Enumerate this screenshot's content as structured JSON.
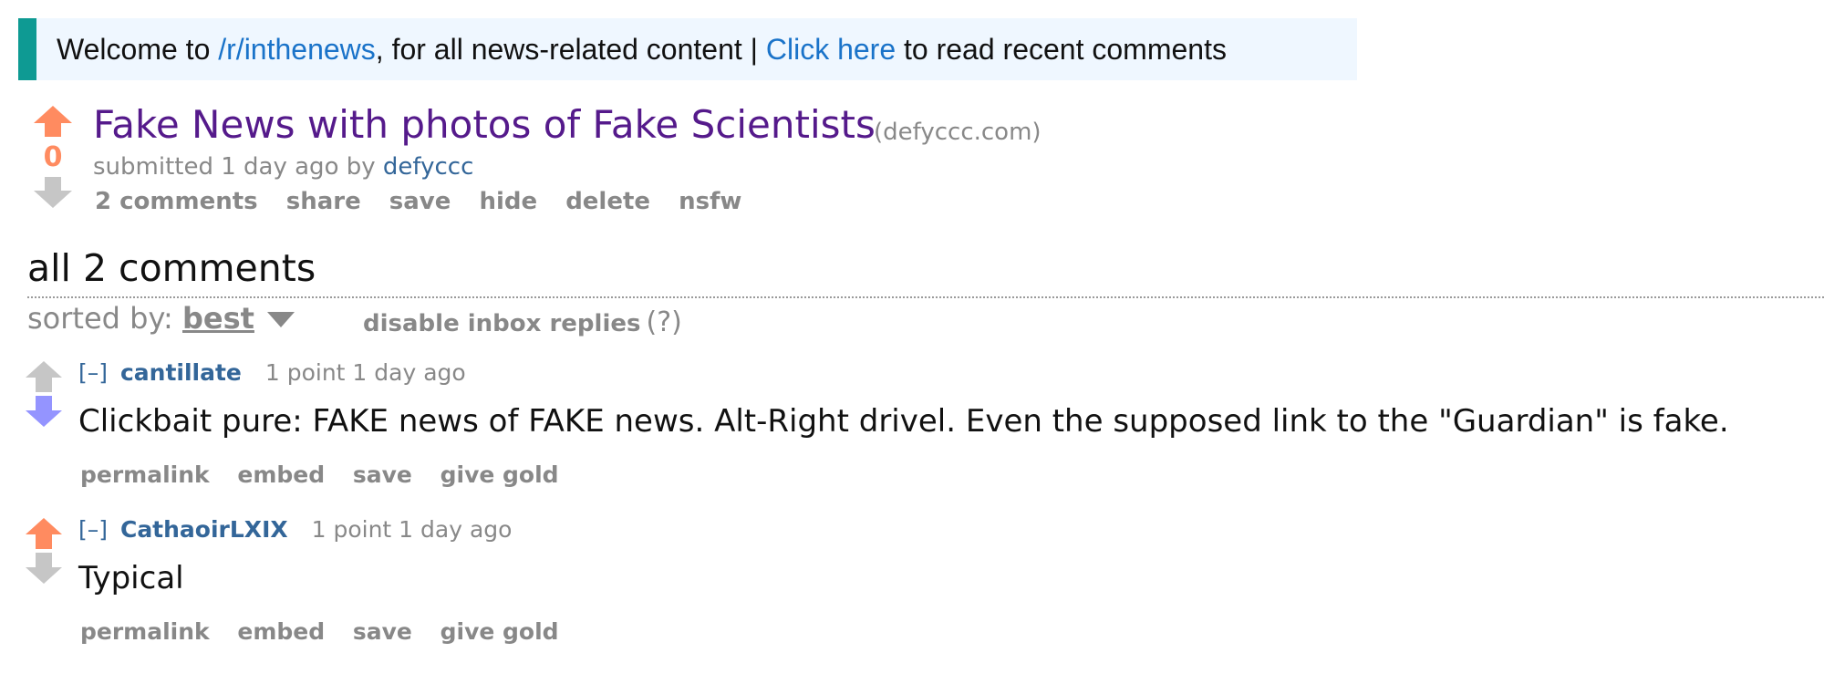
{
  "banner": {
    "prefix": "Welcome to ",
    "subreddit_link": "/r/inthenews",
    "middle": ", for all news-related content | ",
    "click_link": "Click here",
    "suffix": " to read recent comments"
  },
  "post": {
    "score": "0",
    "title": "Fake News with photos of Fake Scientists",
    "domain": "(defyccc.com)",
    "submitted_prefix": "submitted 1 day ago by ",
    "author": "defyccc",
    "buttons": [
      "2 comments",
      "share",
      "save",
      "hide",
      "delete",
      "nsfw"
    ],
    "upvoted": true
  },
  "comments_section": {
    "title": "all 2 comments",
    "sorted_label": "sorted by: ",
    "sorted_value": "best",
    "inbox_label": "disable inbox replies",
    "inbox_help": "(?)"
  },
  "comments": [
    {
      "toggle": "[–]",
      "user": "cantillate",
      "meta": "1 point 1 day ago",
      "body": "Clickbait pure: FAKE news of FAKE news. Alt-Right drivel. Even the supposed link to the \"Guardian\" is fake.",
      "buttons": [
        "permalink",
        "embed",
        "save",
        "give gold"
      ],
      "vote": "down"
    },
    {
      "toggle": "[–]",
      "user": "CathaoirLXIX",
      "meta": "1 point 1 day ago",
      "body": "Typical",
      "buttons": [
        "permalink",
        "embed",
        "save",
        "give gold"
      ],
      "vote": "up"
    }
  ],
  "colors": {
    "upvote": "#ff8b60",
    "downvote": "#9494ff",
    "neutral_arrow": "#c6c6c6",
    "accent": "#0e9a93",
    "link": "#1a73c9",
    "visited_title": "#551a8b"
  }
}
